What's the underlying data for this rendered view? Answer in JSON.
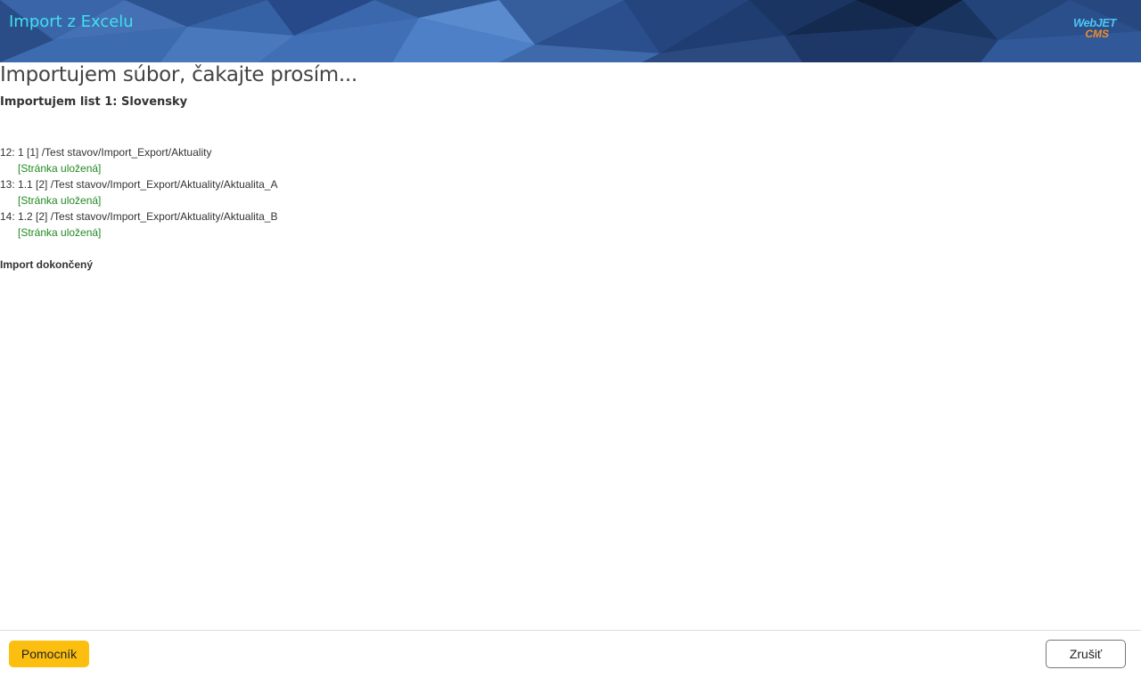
{
  "header": {
    "title": "Import z Excelu",
    "logo_line1": "WebJET",
    "logo_line2": "CMS",
    "title_color": "#3fe0f0"
  },
  "main": {
    "heading": "Importujem súbor, čakajte prosím...",
    "sheet_heading": "Importujem list 1: Slovensky",
    "log": [
      {
        "line": "12: 1 [1] /Test stavov/Import_Export/Aktuality",
        "status": "[Stránka uložená]"
      },
      {
        "line": "13: 1.1 [2] /Test stavov/Import_Export/Aktuality/Aktualita_A",
        "status": "[Stránka uložená]"
      },
      {
        "line": "14: 1.2 [2] /Test stavov/Import_Export/Aktuality/Aktualita_B",
        "status": "[Stránka uložená]"
      }
    ],
    "done": "Import dokončený",
    "status_color": "#22891f"
  },
  "footer": {
    "help_label": "Pomocník",
    "cancel_label": "Zrušiť",
    "help_color": "#fcbf0f"
  }
}
